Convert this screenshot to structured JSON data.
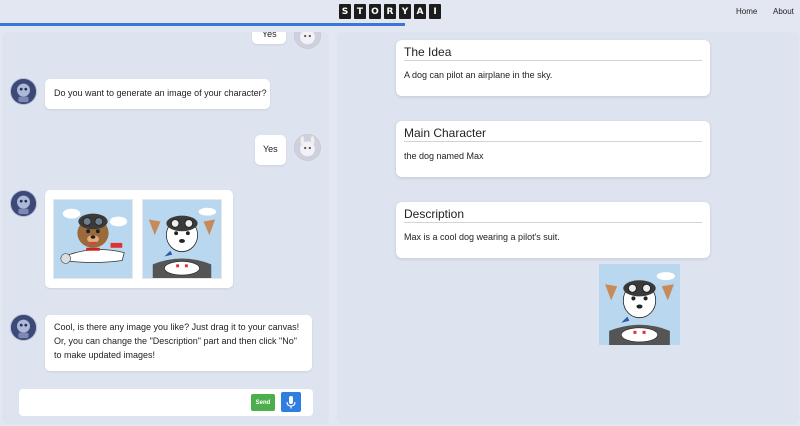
{
  "app": {
    "logo_letters": [
      "S",
      "T",
      "O",
      "R",
      "Y",
      "A",
      "I"
    ],
    "accent": "#3a78d8"
  },
  "nav": {
    "home": "Home",
    "about": "About"
  },
  "chat": {
    "messages": [
      {
        "from": "user",
        "text": "Yes"
      },
      {
        "from": "bot",
        "text": "Do you want to generate an image of your character?"
      },
      {
        "from": "user",
        "text": "Yes"
      },
      {
        "from": "bot",
        "type": "images",
        "images": [
          "aviator-dog-airplane",
          "aviator-dog-cockpit"
        ]
      },
      {
        "from": "bot",
        "text": "Cool, is there any image you like? Just drag it to your canvas! Or, you can change the \"Description\" part and then click \"No\" to make updated images!"
      }
    ],
    "input": {
      "placeholder": "",
      "value": ""
    },
    "send_label": "Send",
    "mic_icon": "microphone-icon"
  },
  "canvas": {
    "cards": [
      {
        "title": "The Idea",
        "text": "A dog can pilot an airplane in the sky."
      },
      {
        "title": "Main Character",
        "text": "the dog named Max"
      },
      {
        "title": "Description",
        "text": "Max is a cool dog wearing a pilot's suit."
      }
    ],
    "placed_image": "aviator-dog-cockpit"
  }
}
